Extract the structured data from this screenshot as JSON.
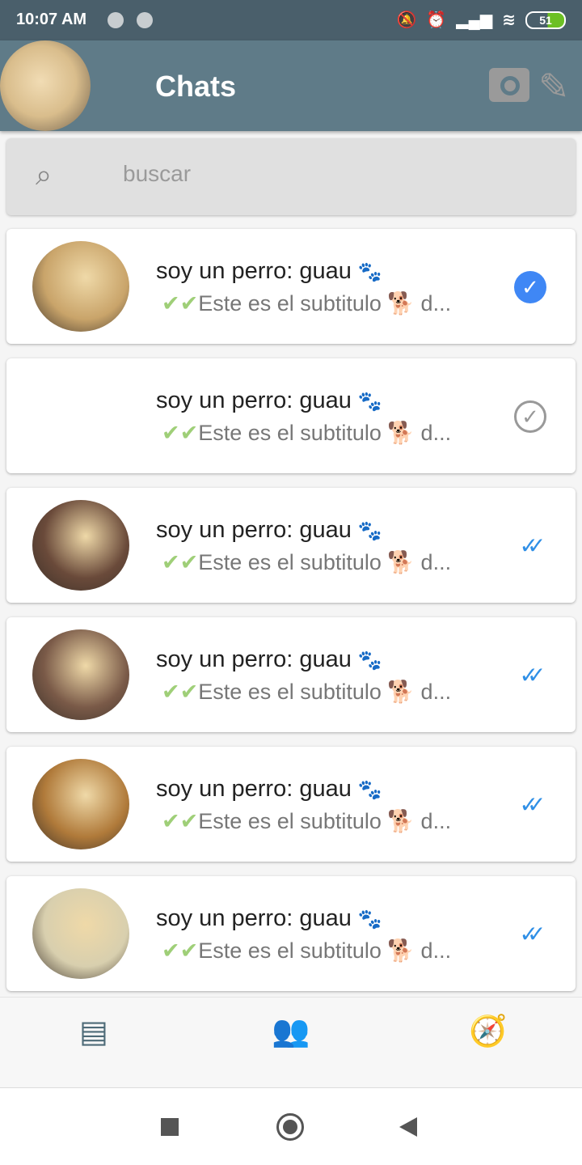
{
  "status_bar": {
    "time": "10:07 AM",
    "battery": "51"
  },
  "header": {
    "title": "Chats"
  },
  "search": {
    "placeholder": "buscar"
  },
  "chats": [
    {
      "title": "soy un perro: guau",
      "title_emoji": "🐾",
      "checks": "✔✔",
      "subtitle": "Este es el subtitulo",
      "subtitle_emoji": "🐕",
      "ellipsis": "d...",
      "status": "read-filled",
      "avatar_color": "#c9a46a"
    },
    {
      "title": "soy un perro: guau",
      "title_emoji": "🐾",
      "checks": "✔✔",
      "subtitle": "Este es el subtitulo",
      "subtitle_emoji": "🐕",
      "ellipsis": "d...",
      "status": "sent-outline",
      "avatar_color": ""
    },
    {
      "title": "soy un perro: guau",
      "title_emoji": "🐾",
      "checks": "✔✔",
      "subtitle": "Este es el subtitulo",
      "subtitle_emoji": "🐕",
      "ellipsis": "d...",
      "status": "double-check",
      "avatar_color": "#6a4a3a"
    },
    {
      "title": "soy un perro: guau",
      "title_emoji": "🐾",
      "checks": "✔✔",
      "subtitle": "Este es el subtitulo",
      "subtitle_emoji": "🐕",
      "ellipsis": "d...",
      "status": "double-check",
      "avatar_color": "#7a5a48"
    },
    {
      "title": "soy un perro: guau",
      "title_emoji": "🐾",
      "checks": "✔✔",
      "subtitle": "Este es el subtitulo",
      "subtitle_emoji": "🐕",
      "ellipsis": "d...",
      "status": "double-check",
      "avatar_color": "#b07a3a"
    },
    {
      "title": "soy un perro: guau",
      "title_emoji": "🐾",
      "checks": "✔✔",
      "subtitle": "Este es el subtitulo",
      "subtitle_emoji": "🐕",
      "ellipsis": "d...",
      "status": "double-check",
      "avatar_color": "#d8cfae"
    }
  ],
  "bottom_nav": [
    "chats",
    "contacts",
    "explore"
  ]
}
